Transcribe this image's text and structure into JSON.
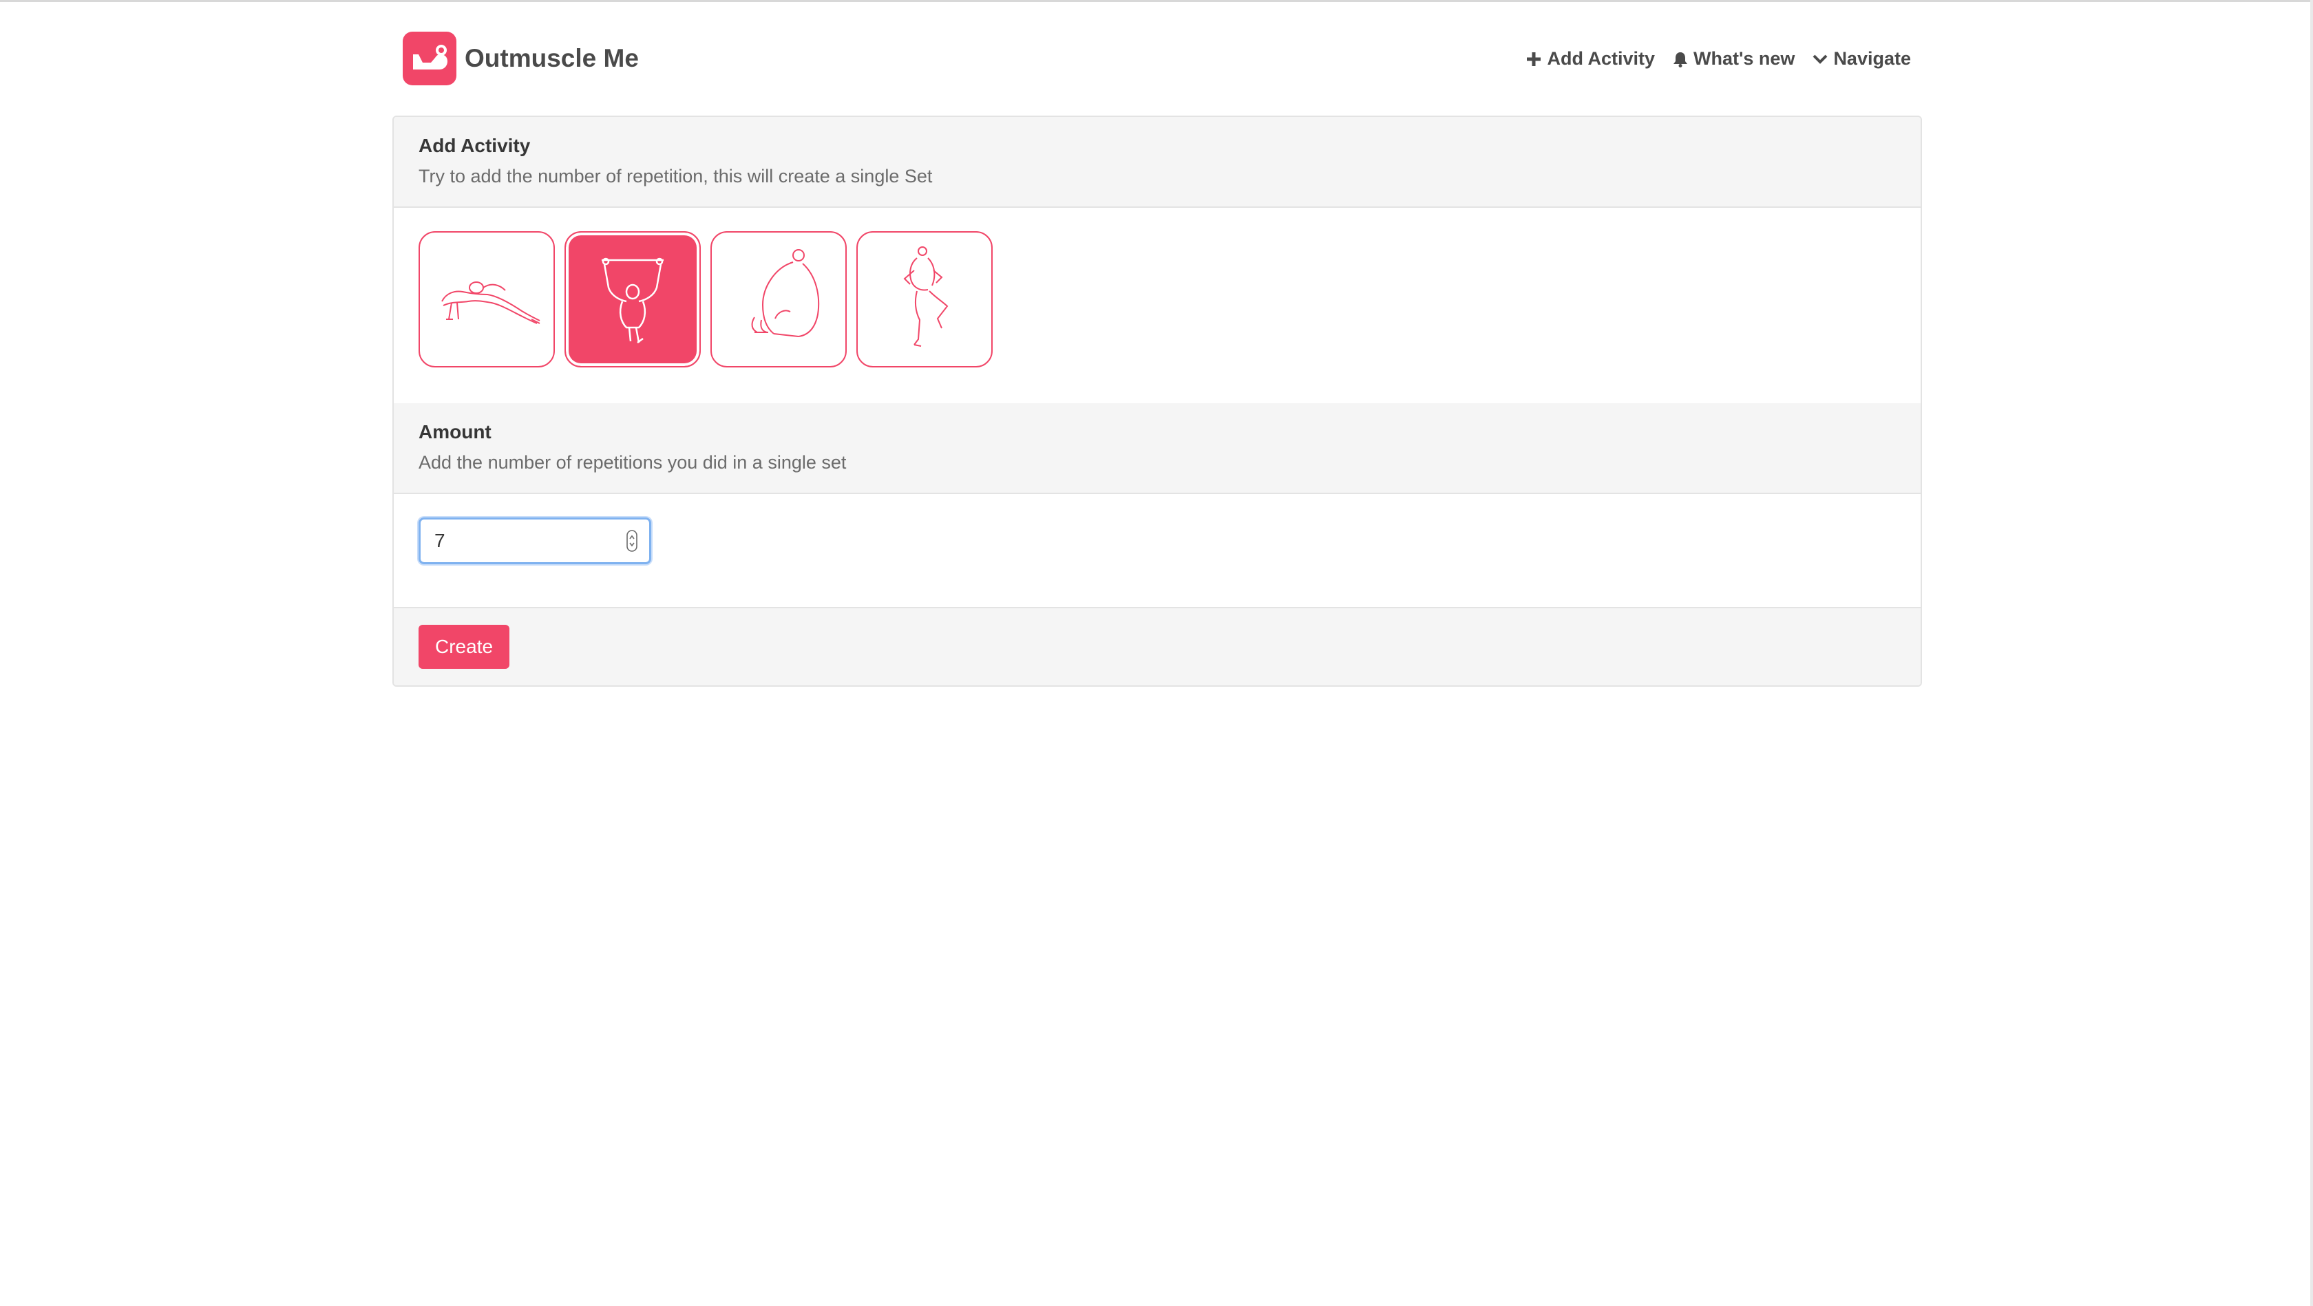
{
  "brand": {
    "name": "Outmuscle Me",
    "icon": "flexed-arm-icon",
    "accent": "#f14668"
  },
  "nav": {
    "add_activity": "Add Activity",
    "whats_new": "What's new",
    "navigate": "Navigate"
  },
  "add_activity": {
    "title": "Add Activity",
    "subtitle": "Try to add the number of repetition, this will create a single Set",
    "options": [
      {
        "icon": "pushup-icon",
        "selected": false
      },
      {
        "icon": "pullup-icon",
        "selected": true
      },
      {
        "icon": "squat-icon",
        "selected": false
      },
      {
        "icon": "lunge-icon",
        "selected": false
      }
    ]
  },
  "amount": {
    "title": "Amount",
    "subtitle": "Add the number of repetitions you did in a single set",
    "value": "7"
  },
  "footer": {
    "create_label": "Create"
  }
}
